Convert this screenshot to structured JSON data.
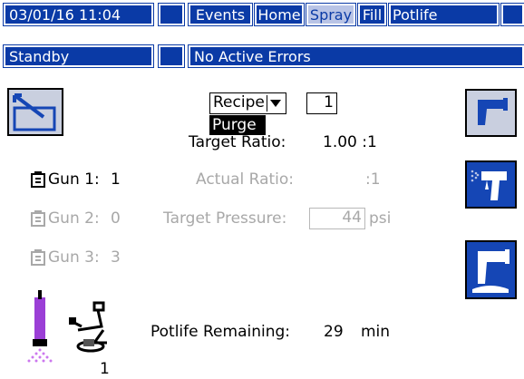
{
  "header": {
    "datetime": "03/01/16 11:04",
    "status": "Standby",
    "errors": "No Active Errors",
    "tabs": [
      {
        "label": "Events",
        "active": false
      },
      {
        "label": "Home",
        "active": false
      },
      {
        "label": "Spray",
        "active": true
      },
      {
        "label": "Fill",
        "active": false
      },
      {
        "label": "Potlife",
        "active": false
      }
    ]
  },
  "recipe": {
    "label": "Recipe",
    "value": "1",
    "dropdown_option": "Purge"
  },
  "target_ratio": {
    "label": "Target Ratio:",
    "value": "1.00 :1"
  },
  "actual_ratio": {
    "label": "Actual Ratio:",
    "value": ":1"
  },
  "target_pressure": {
    "label": "Target Pressure:",
    "value": "44",
    "unit": "psi"
  },
  "guns": [
    {
      "label": "Gun 1:",
      "value": "1",
      "enabled": true
    },
    {
      "label": "Gun 2:",
      "value": "0",
      "enabled": false
    },
    {
      "label": "Gun 3:",
      "value": "3",
      "enabled": false
    }
  ],
  "potlife": {
    "label": "Potlife Remaining:",
    "value": "29",
    "unit": "min"
  },
  "station_number": "1",
  "colors": {
    "header_blue": "#0a3aa6",
    "active_tab": "#b9c4e6",
    "purple": "#9b3fd6",
    "button_blue": "#1546b5"
  },
  "icons": [
    "mix-screen-icon",
    "gun-flush-icon",
    "gun-trigger-icon",
    "gun-purge-icon",
    "gun-icon",
    "spray-gun-purple-icon",
    "robot-arm-icon"
  ]
}
